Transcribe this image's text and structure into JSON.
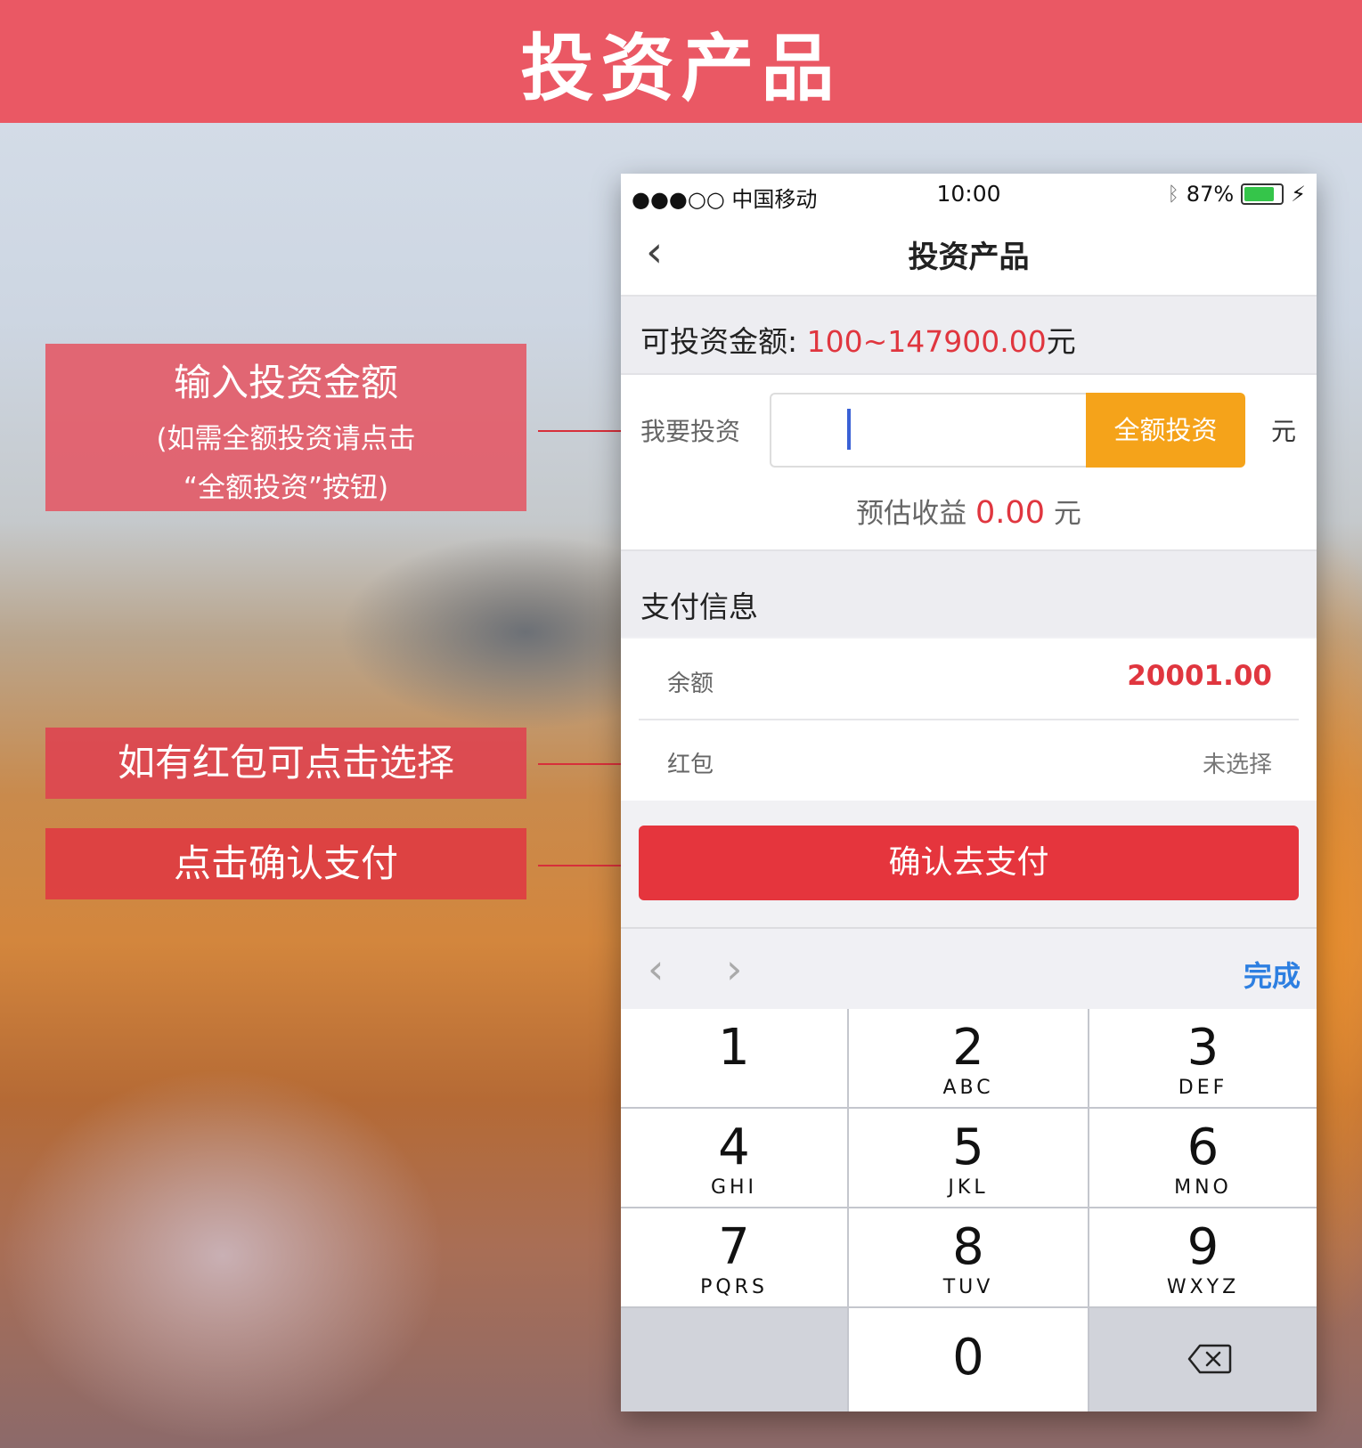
{
  "banner": {
    "title": "投资产品"
  },
  "callouts": {
    "input": {
      "line1": "输入投资金额",
      "line2": "(如需全额投资请点击",
      "line3": "“全额投资”按钮)"
    },
    "redpacket": "如有红包可点击选择",
    "confirm": "点击确认支付"
  },
  "status_bar": {
    "carrier": "●●●○○ 中国移动",
    "time": "10:00",
    "battery": "87%",
    "battery_level": 0.87
  },
  "nav": {
    "title": "投资产品",
    "back": "‹"
  },
  "range": {
    "label": "可投资金额:",
    "value": "100~147900.00",
    "unit": "元"
  },
  "invest": {
    "label": "我要投资",
    "input_value": "",
    "full_button": "全额投资",
    "unit": "元",
    "estimate_label": "预估收益",
    "estimate_value": "0.00",
    "estimate_unit": "元"
  },
  "payment": {
    "title": "支付信息",
    "balance_label": "余额",
    "balance_value": "20001.00",
    "redpacket_label": "红包",
    "redpacket_value": "未选择"
  },
  "confirm_button": "确认去支付",
  "keyboard": {
    "prev": "‹",
    "next": "›",
    "done": "完成",
    "keys": [
      {
        "num": "1",
        "sub": ""
      },
      {
        "num": "2",
        "sub": "ABC"
      },
      {
        "num": "3",
        "sub": "DEF"
      },
      {
        "num": "4",
        "sub": "GHI"
      },
      {
        "num": "5",
        "sub": "JKL"
      },
      {
        "num": "6",
        "sub": "MNO"
      },
      {
        "num": "7",
        "sub": "PQRS"
      },
      {
        "num": "8",
        "sub": "TUV"
      },
      {
        "num": "9",
        "sub": "WXYZ"
      },
      {
        "num": "0",
        "sub": ""
      }
    ]
  },
  "colors": {
    "banner": "#ea5864",
    "accent_red": "#e0363f",
    "orange": "#f5a31a",
    "link_blue": "#2d7fe1"
  }
}
